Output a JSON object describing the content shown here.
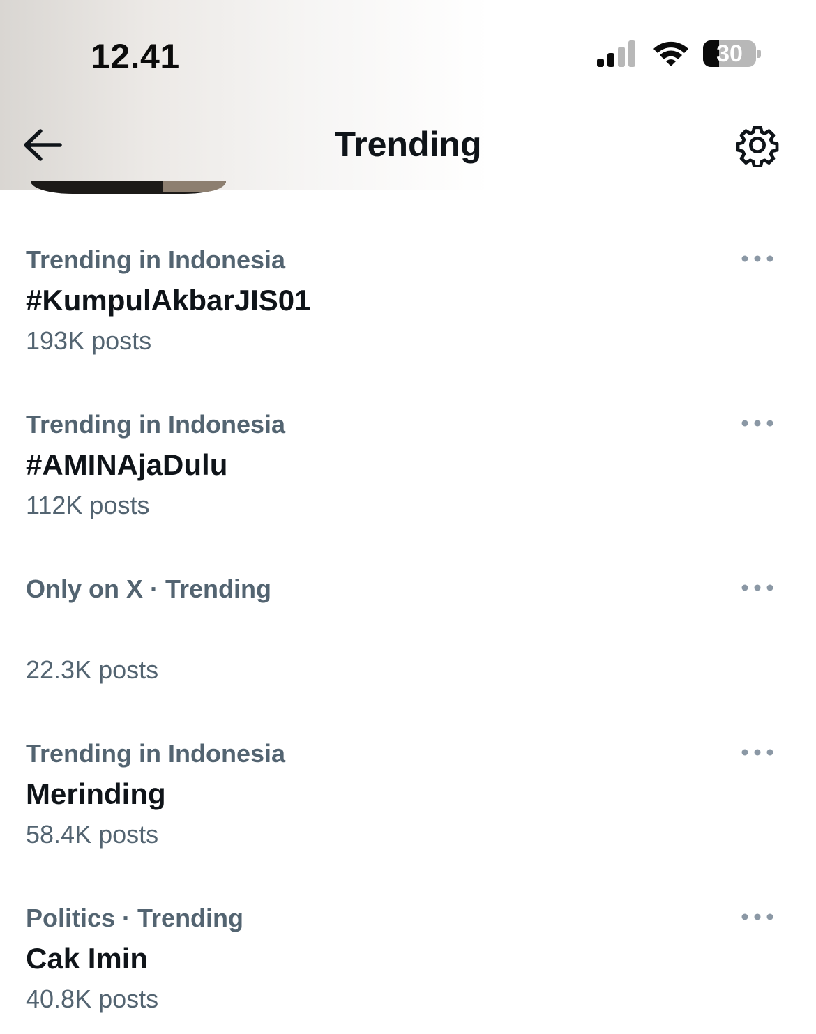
{
  "status_bar": {
    "time": "12.41",
    "battery_level": "30",
    "battery_fraction": 0.3,
    "signal_bars_active": 2,
    "icons": [
      "cellular-signal-icon",
      "wifi-icon",
      "battery-icon"
    ]
  },
  "header": {
    "title": "Trending",
    "back_icon": "arrow-left-icon",
    "settings_icon": "gear-icon"
  },
  "colors": {
    "primary_text": "#0f1419",
    "secondary_text": "#536471",
    "more_dots": "#8b98a5"
  },
  "trends": [
    {
      "context": "Trending in Indonesia",
      "name": "#KumpulAkbarJIS01",
      "posts": "193K posts"
    },
    {
      "context": "Trending in Indonesia",
      "name": "#AMINAjaDulu",
      "posts": "112K posts"
    },
    {
      "context": "Only on X · Trending",
      "name": "",
      "posts": "22.3K posts"
    },
    {
      "context": "Trending in Indonesia",
      "name": "Merinding",
      "posts": "58.4K posts"
    },
    {
      "context": "Politics · Trending",
      "name": "Cak Imin",
      "posts": "40.8K posts"
    }
  ]
}
